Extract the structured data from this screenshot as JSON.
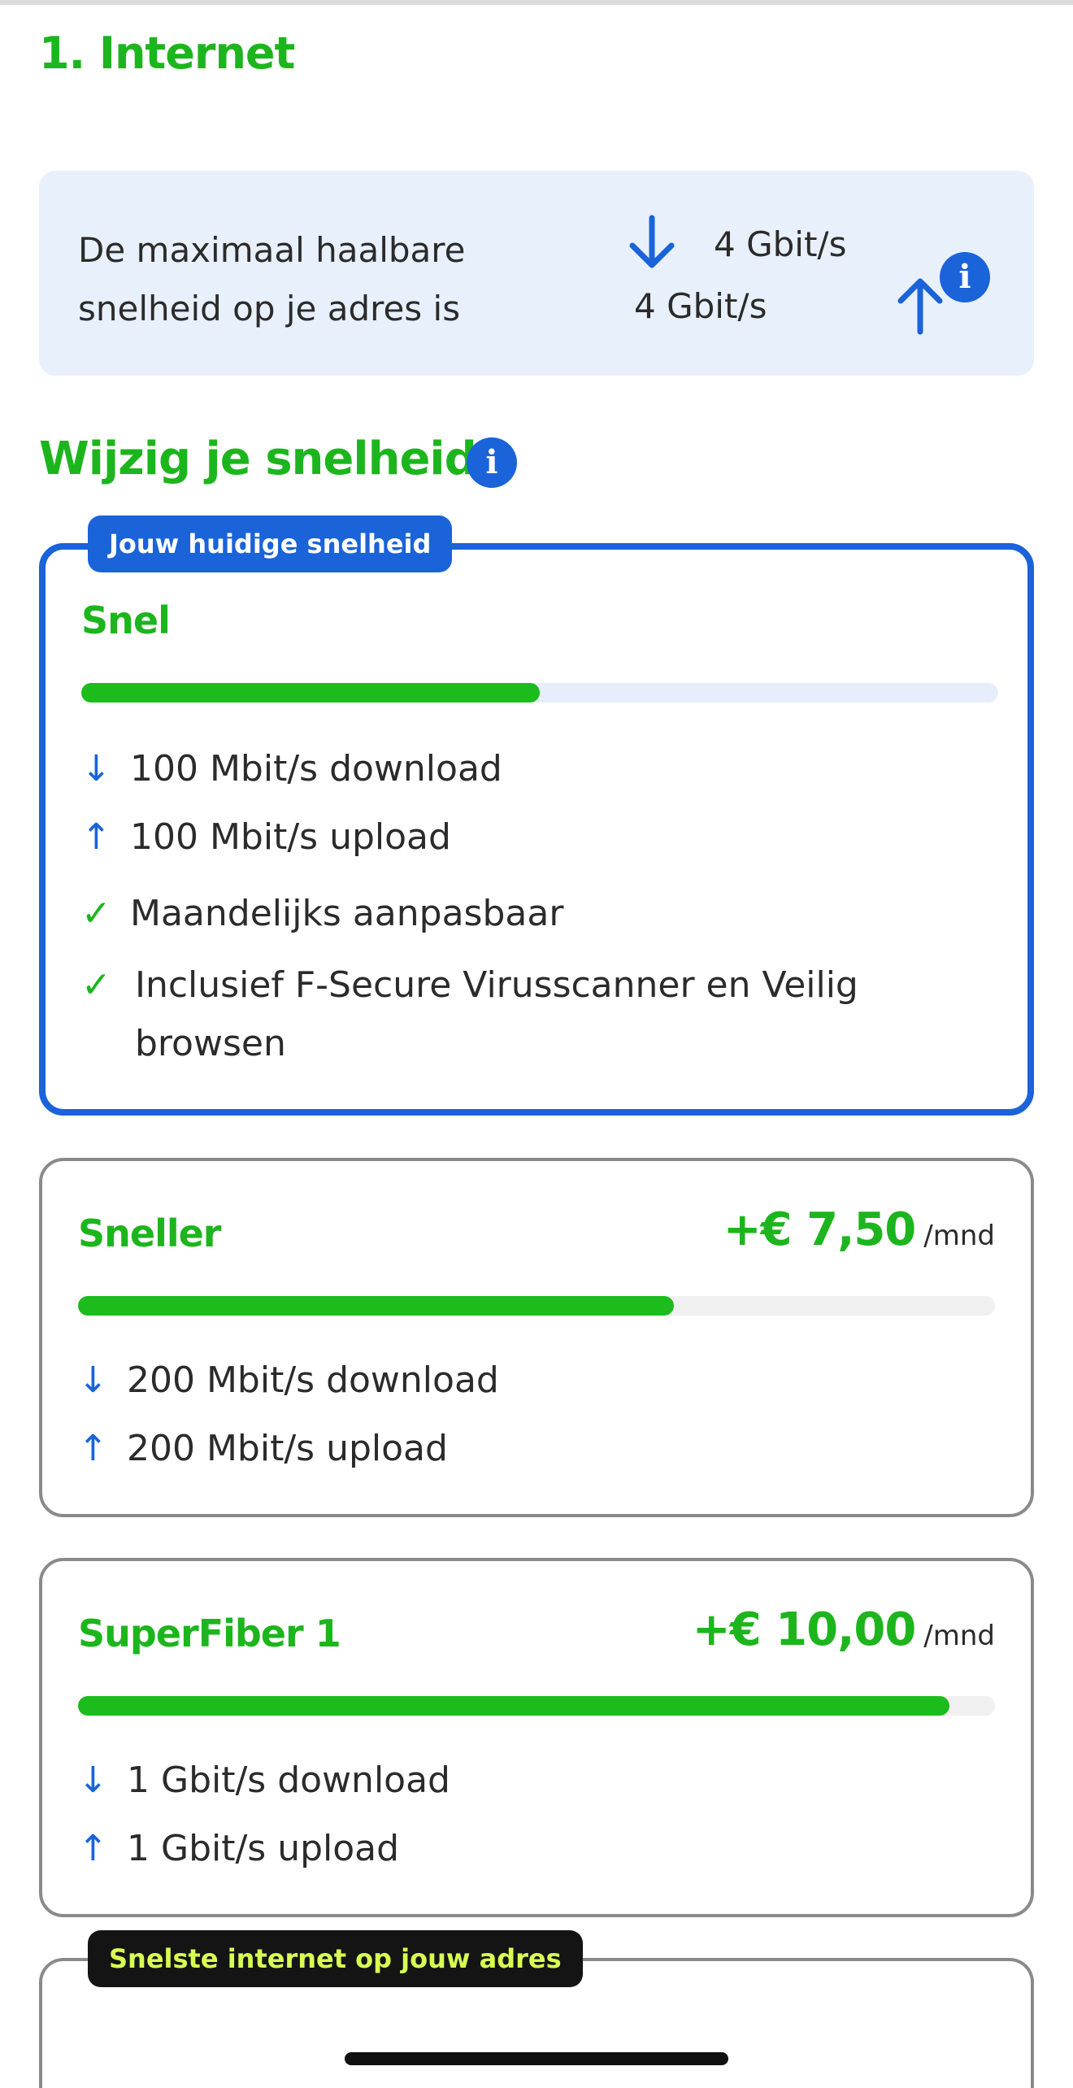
{
  "section_title": "1. Internet",
  "max_speed": {
    "text": "De maximaal haalbare snelheid op je adres is",
    "download": "4 Gbit/s",
    "upload": "4 Gbit/s"
  },
  "change_title": "Wijzig je snelheid",
  "plans": [
    {
      "badge": "Jouw huidige snelheid",
      "name": "Snel",
      "speed_fraction": 0.5,
      "download": "100 Mbit/s download",
      "upload": "100 Mbit/s upload",
      "features": [
        "Maandelijks aanpasbaar",
        "Inclusief F-Secure Virusscanner en Veilig browsen"
      ]
    },
    {
      "name": "Sneller",
      "price": "+€ 7,50",
      "unit": "/mnd",
      "speed_fraction": 0.65,
      "download": "200 Mbit/s download",
      "upload": "200 Mbit/s upload"
    },
    {
      "name": "SuperFiber 1",
      "price": "+€ 10,00",
      "unit": "/mnd",
      "speed_fraction": 0.95,
      "download": "1 Gbit/s download",
      "upload": "1 Gbit/s upload"
    },
    {
      "badge": "Snelste internet op jouw adres"
    }
  ],
  "icons": {
    "info": "info-icon",
    "down": "arrow-down-icon",
    "up": "arrow-up-icon",
    "check": "checkmark-icon"
  },
  "colors": {
    "brand_green": "#1db51d",
    "bar_green": "#1bbc1b",
    "accent_blue": "#1a63d9",
    "info_bg": "#e8f0fb",
    "badge_dark": "#141414",
    "badge_dark_text": "#d8ff52"
  }
}
